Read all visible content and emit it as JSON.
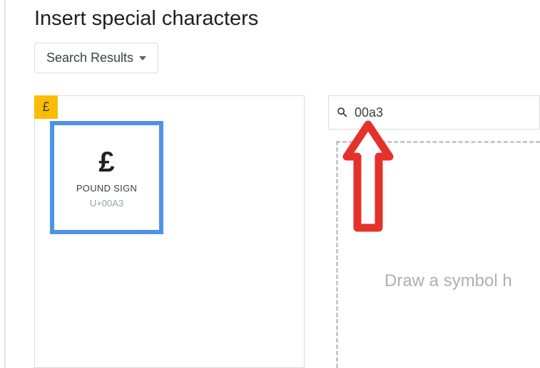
{
  "dialog": {
    "title": "Insert special characters"
  },
  "dropdown": {
    "label": "Search Results"
  },
  "result": {
    "glyph": "£",
    "chip": "£",
    "name": "POUND SIGN",
    "code": "U+00A3"
  },
  "search": {
    "value": "00a3"
  },
  "draw": {
    "placeholder": "Draw a symbol h"
  }
}
